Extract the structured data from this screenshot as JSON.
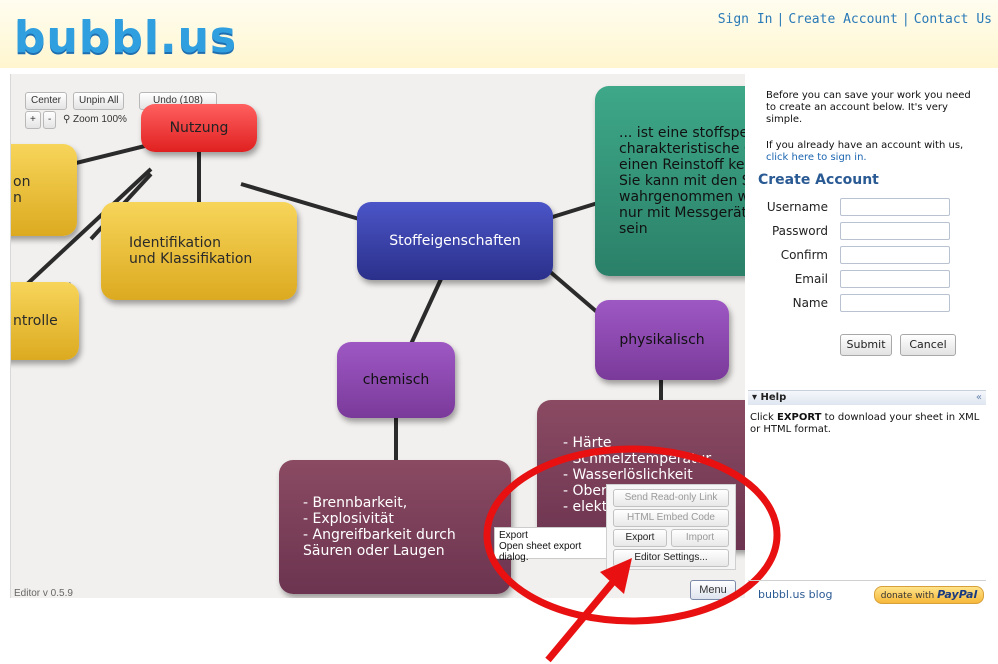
{
  "header": {
    "logo_text": "bubbl.us",
    "links": [
      "Sign In",
      "Create Account",
      "Contact Us"
    ]
  },
  "toolbar": {
    "center": "Center",
    "unpin_all": "Unpin All",
    "undo": "Undo (108)",
    "zoom_in": "+",
    "zoom_out": "-",
    "zoom_label": "Zoom 100%"
  },
  "bubbles": {
    "nutzung": "Nutzung",
    "left_top": "on\nn",
    "identifikation": "Identifikation\nund Klassifikation",
    "kontrolle": "ntrolle",
    "stoffeigenschaften": "Stoffeigenschaften",
    "teal": "... ist eine stoffspe\ncharakteristische C\neinen Reinstoff ker\nSie kann mit den S\nwahrgenommen w\nnur mit Messgerät\nsein",
    "chemisch": "chemisch",
    "physikalisch": "physikalisch",
    "chem_details": "- Brennbarkeit,\n- Explosivität\n- Angreifbarkeit durch\nSäuren  oder Laugen",
    "phys_details": "- Härte\n- Schmelztemperatur\n- Wasserlöslichkeit\n- Oberfläche\n- elektr"
  },
  "editor_version": "Editor v 0.5.9",
  "tooltip": {
    "title": "Export",
    "desc": "Open sheet export dialog."
  },
  "menu": {
    "send_readonly": "Send Read-only Link",
    "html_embed": "HTML Embed Code",
    "export": "Export",
    "import": "Import",
    "editor_settings": "Editor Settings...",
    "menu_button": "Menu"
  },
  "panel": {
    "intro": "Before you can save your work you need to create an account below. It's very simple.",
    "intro2_text": "If you already have an account with us,",
    "intro2_link": "click here to sign in.",
    "create_title": "Create Account",
    "fields": [
      "Username",
      "Password",
      "Confirm",
      "Email",
      "Name"
    ],
    "submit": "Submit",
    "cancel": "Cancel",
    "help_title": "Help",
    "help_collapse": "«",
    "help_pre": "Click",
    "help_keyword": "EXPORT",
    "help_post": "to download your sheet in XML or HTML format.",
    "blog": "bubbl.us blog",
    "donate_pre": "donate with",
    "donate_brand": "PayPal"
  },
  "colors": {
    "annotation": "#e81010",
    "link": "#2a7ab8",
    "canvas": "#f2f0ee"
  }
}
